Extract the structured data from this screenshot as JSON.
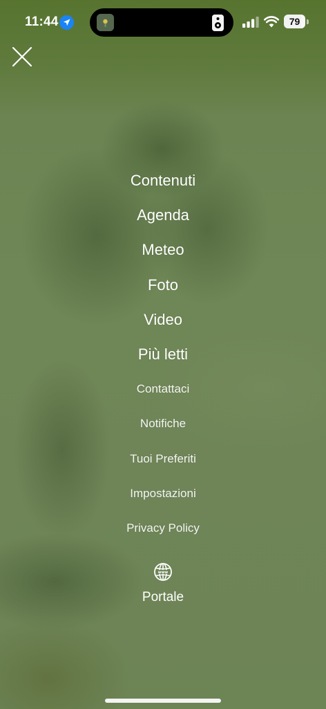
{
  "status_bar": {
    "time": "11:44",
    "battery_level": "79",
    "icons": [
      "location-arrow-icon",
      "app-icon",
      "speaker-icon",
      "cellular-signal-icon",
      "wifi-icon",
      "battery-icon"
    ]
  },
  "close": {
    "icon": "close-icon"
  },
  "menu": {
    "primary_items": [
      {
        "label": "Contenuti"
      },
      {
        "label": "Agenda"
      },
      {
        "label": "Meteo"
      },
      {
        "label": "Foto"
      },
      {
        "label": "Video"
      },
      {
        "label": "Più letti"
      }
    ],
    "secondary_items": [
      {
        "label": "Contattaci"
      },
      {
        "label": "Notifiche"
      },
      {
        "label": "Tuoi Preferiti"
      },
      {
        "label": "Impostazioni"
      },
      {
        "label": "Privacy Policy"
      }
    ]
  },
  "portal": {
    "icon": "globe-icon",
    "label": "Portale"
  },
  "colors": {
    "text": "#ffffff",
    "background": "#6f8555",
    "location_badge": "#1a84f5"
  }
}
